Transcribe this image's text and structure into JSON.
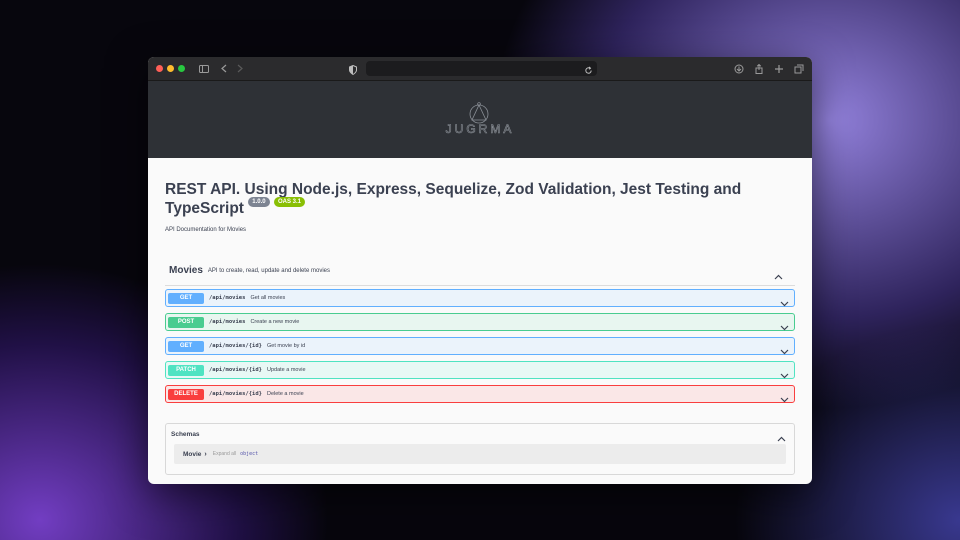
{
  "browser": {
    "traffic_colors": [
      "#ff5f57",
      "#febc2e",
      "#28c840"
    ]
  },
  "banner": {
    "logo_text": "JUGRMA"
  },
  "api": {
    "title": "REST API. Using Node.js, Express, Sequelize, Zod Validation, Jest Testing and TypeScript",
    "version_badge": "1.0.0",
    "oas_badge": "OAS 3.1",
    "description": "API Documentation for Movies"
  },
  "tag": {
    "name": "Movies",
    "description": "API to create, read, update and delete movies"
  },
  "operations": [
    {
      "method": "GET",
      "path": "/api/movies",
      "summary": "Get all movies"
    },
    {
      "method": "POST",
      "path": "/api/movies",
      "summary": "Create a new movie"
    },
    {
      "method": "GET",
      "path": "/api/movies/{id}",
      "summary": "Get movie by id"
    },
    {
      "method": "PATCH",
      "path": "/api/movies/{id}",
      "summary": "Update a movie"
    },
    {
      "method": "DELETE",
      "path": "/api/movies/{id}",
      "summary": "Delete a movie"
    }
  ],
  "schemas": {
    "title": "Schemas",
    "model_name": "Movie",
    "model_arrow": "›",
    "expand_label": "Expand all",
    "model_type": "object"
  },
  "colors": {
    "get": "#61affe",
    "post": "#49cc90",
    "patch": "#50e3c2",
    "delete": "#f93e3e"
  }
}
